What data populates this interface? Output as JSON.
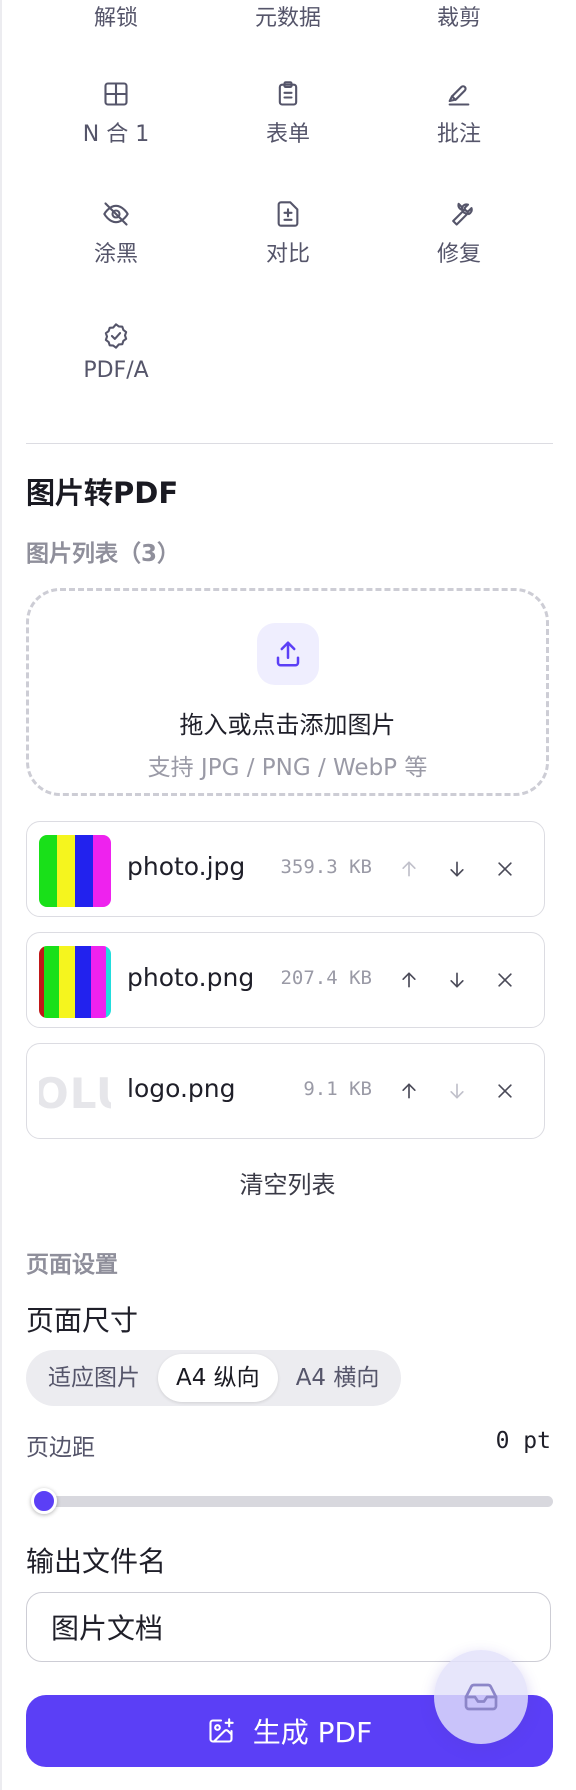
{
  "tools": {
    "row0": [
      {
        "label": "解锁",
        "icon": "unlock-icon"
      },
      {
        "label": "元数据",
        "icon": "metadata-icon"
      },
      {
        "label": "裁剪",
        "icon": "crop-icon"
      }
    ],
    "row1": [
      {
        "label": "N 合 1",
        "icon": "grid-icon"
      },
      {
        "label": "表单",
        "icon": "clipboard-form-icon"
      },
      {
        "label": "批注",
        "icon": "annotate-pen-icon"
      }
    ],
    "row2": [
      {
        "label": "涂黑",
        "icon": "eye-off-icon"
      },
      {
        "label": "对比",
        "icon": "file-diff-icon"
      },
      {
        "label": "修复",
        "icon": "wrench-icon"
      }
    ],
    "row3": [
      {
        "label": "PDF/A",
        "icon": "badge-check-icon"
      }
    ]
  },
  "section": {
    "title": "图片转PDF",
    "list_title": "图片列表（3）"
  },
  "dropzone": {
    "main_text": "拖入或点击添加图片",
    "sub_text": "支持 JPG / PNG / WebP 等",
    "icon": "upload-icon"
  },
  "files": [
    {
      "name": "photo.jpg",
      "size": "359.3 KB",
      "up_enabled": false,
      "down_enabled": true
    },
    {
      "name": "photo.png",
      "size": "207.4 KB",
      "up_enabled": true,
      "down_enabled": true
    },
    {
      "name": "logo.png",
      "size": "9.1 KB",
      "up_enabled": true,
      "down_enabled": false,
      "thumb_text": "OLU"
    }
  ],
  "clear_label": "清空列表",
  "settings": {
    "title": "页面设置",
    "page_size_label": "页面尺寸",
    "page_size_options": [
      "适应图片",
      "A4 纵向",
      "A4 横向"
    ],
    "page_size_selected": "A4 纵向",
    "margin_label": "页边距",
    "margin_value": "0 pt",
    "margin_fraction": 0,
    "output_name_label": "输出文件名",
    "output_name_value": "图片文档"
  },
  "generate_label": "生成 PDF",
  "colors": {
    "accent": "#5b3ff6",
    "accent_light": "#efeefe",
    "muted_text": "#9a9aa6",
    "border": "#dcdce2"
  }
}
